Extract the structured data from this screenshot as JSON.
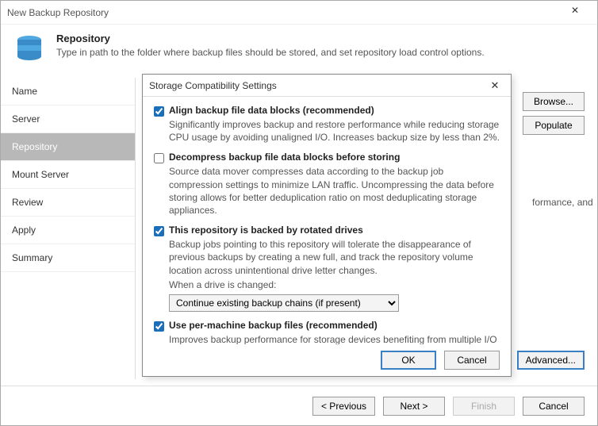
{
  "window": {
    "title": "New Backup Repository"
  },
  "header": {
    "title": "Repository",
    "subtitle": "Type in path to the folder where backup files should be stored, and set repository load control options."
  },
  "sidebar": {
    "items": [
      "Name",
      "Server",
      "Repository",
      "Mount Server",
      "Review",
      "Apply",
      "Summary"
    ],
    "active_index": 2
  },
  "content": {
    "browse": "Browse...",
    "populate": "Populate",
    "advanced": "Advanced...",
    "behind_text": "formance, and"
  },
  "modal": {
    "title": "Storage Compatibility Settings",
    "opts": [
      {
        "label": "Align backup file data blocks (recommended)",
        "desc": "Significantly improves backup and restore performance while reducing storage CPU usage by avoiding unaligned I/O. Increases backup size by less than 2%.",
        "checked": true
      },
      {
        "label": "Decompress backup file data blocks before storing",
        "desc": "Source data mover compresses data according to the backup job compression settings to minimize LAN traffic. Uncompressing the data before storing allows for better deduplication ratio on most deduplicating storage appliances.",
        "checked": false
      },
      {
        "label": "This repository is backed by rotated drives",
        "desc": "Backup jobs pointing to this repository will tolerate the disappearance of previous backups by creating a new full, and track the repository volume location across unintentional drive letter changes.",
        "extra": "When a drive is changed:",
        "select": "Continue existing backup chains (if present)",
        "checked": true
      },
      {
        "label": "Use per-machine backup files (recommended)",
        "desc": "Improves backup performance for storage devices benefiting from multiple I/O streams, such as enterprise grade block storage and deduplicating storage appliances. Enables additional backup management functionality.",
        "checked": true
      }
    ],
    "ok": "OK",
    "cancel": "Cancel"
  },
  "footer": {
    "prev": "< Previous",
    "next": "Next >",
    "finish": "Finish",
    "cancel": "Cancel"
  }
}
